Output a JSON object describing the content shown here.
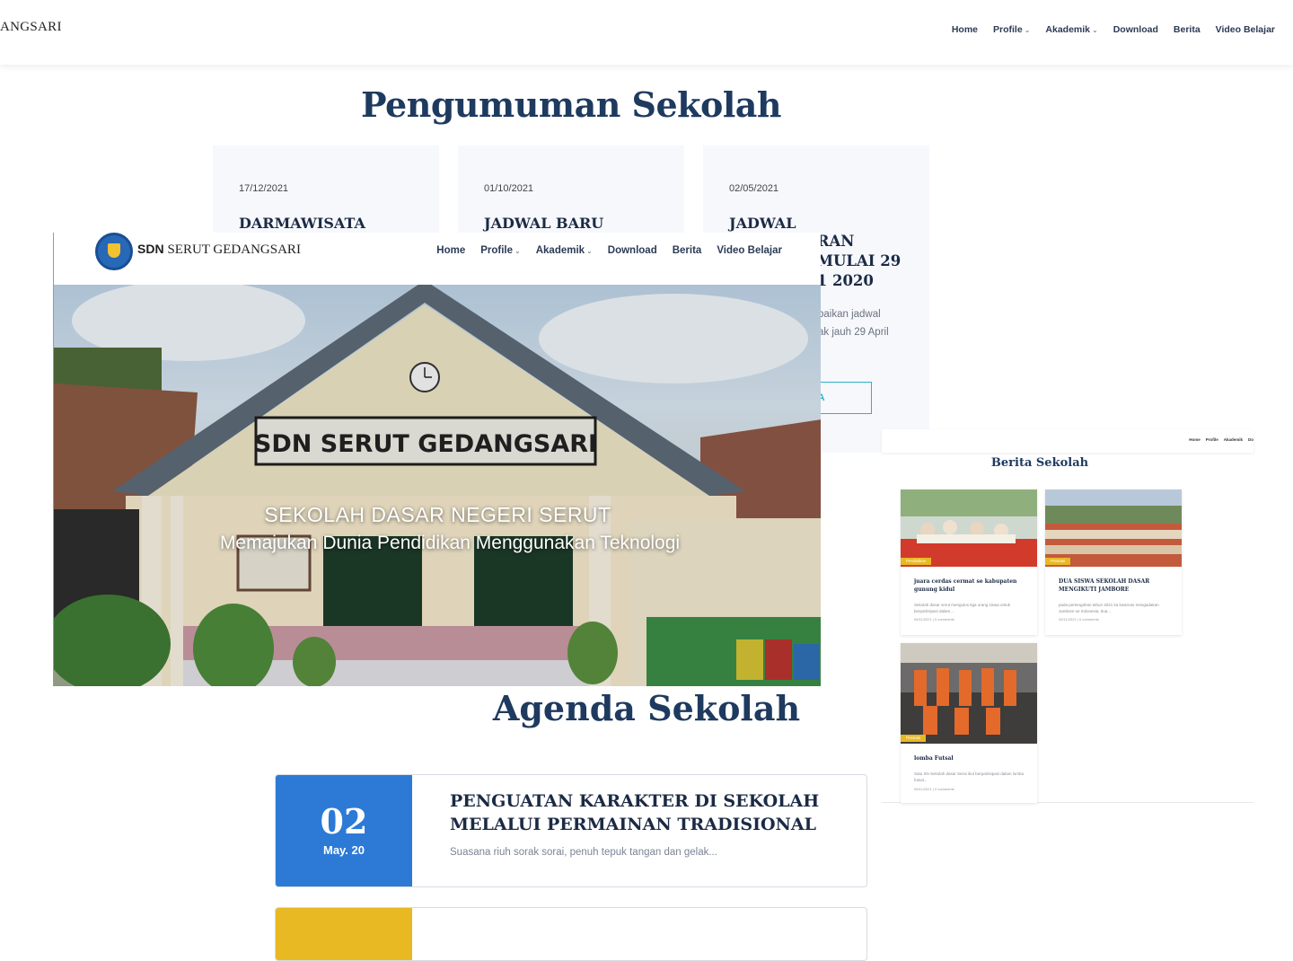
{
  "bg_nav": {
    "brand": "ANGSARI",
    "menu": [
      "Home",
      "Profile",
      "Akademik",
      "Download",
      "Berita",
      "Video Belajar"
    ]
  },
  "pengumuman": {
    "title": "Pengumuman Sekolah",
    "cards": [
      {
        "date": "17/12/2021",
        "title": "DARMAWISATA"
      },
      {
        "date": "01/10/2021",
        "title": "JADWAL BARU"
      },
      {
        "date": "02/05/2021",
        "title": "JADWAL"
      }
    ],
    "card3_partial_title": ".RAN\n MULAI 29\n 1 2020",
    "card3_partial_text": "baikan jadwal\nak jauh 29 April",
    "card3_partial_button": "NYA"
  },
  "hero": {
    "brand_bold": "SDN",
    "brand_rest": "SERUT GEDANGSARI",
    "menu": [
      "Home",
      "Profile",
      "Akademik",
      "Download",
      "Berita",
      "Video Belajar"
    ],
    "sign_text": "SDN SERUT GEDANGSARI",
    "heading": "SEKOLAH DASAR NEGERI SERUT",
    "subheading": "Memajukan Dunia Pendidikan Menggunakan Teknologi"
  },
  "agenda": {
    "title": "Agenda Sekolah",
    "items": [
      {
        "day": "02",
        "month": "May. 20",
        "title": "PENGUATAN KARAKTER DI SEKOLAH MELALUI PERMAINAN TRADISIONAL",
        "excerpt": "Suasana riuh sorak sorai, penuh tepuk tangan dan gelak..."
      }
    ]
  },
  "news": {
    "menu": [
      "Home",
      "Profile",
      "Akademik",
      "Do"
    ],
    "title": "Berita Sekolah",
    "cards": [
      {
        "tag": "Pendidikan",
        "title": "juara cerdas cermat se kabupaten gunung kidul",
        "excerpt": "Sekolah dasar serut mengutus tiga orang siswa untuk berpartisipasi dalam...",
        "meta": "05/11/2021 | 0 comments"
      },
      {
        "tag": "Prestasi",
        "title": "DUA SISWA SEKOLAH DASAR MENGIKUTI JAMBORE",
        "excerpt": "pada pertengahan tahun 2021 ka kwarnas mengadakan Jambore se Indonesia, dua...",
        "meta": "05/11/2021 | 0 comments"
      },
      {
        "tag": "Prestasi",
        "title": "lomba Futsal",
        "excerpt": "Satu SN Sekolah dasar Serut ikut berpartisipasi dalam lomba futsal...",
        "meta": "05/11/2021 | 0 comments"
      }
    ]
  },
  "colors": {
    "navy": "#1e3a5f",
    "agenda_blue": "#2d7ad6",
    "accent_teal": "#2ab3c9",
    "tag_yellow": "#e8b923"
  }
}
